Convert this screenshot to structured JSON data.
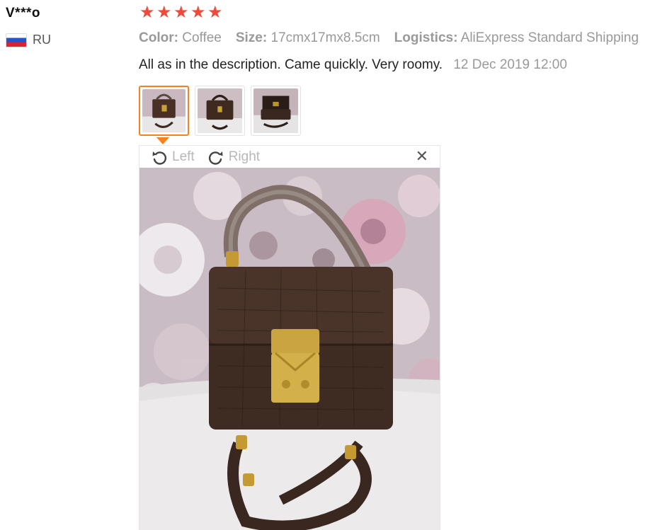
{
  "reviewer": {
    "name": "V***o",
    "country": "RU"
  },
  "rating": {
    "stars": 5,
    "max": 5,
    "color": "#f04a3a"
  },
  "attributes": {
    "color_key": "Color:",
    "color_value": "Coffee",
    "size_key": "Size:",
    "size_value": "17cmx17mx8.5cm",
    "logistics_key": "Logistics:",
    "logistics_value": "AliExpress Standard Shipping"
  },
  "review": {
    "text": "All as in the description. Came quickly. Very roomy.",
    "date": "12 Dec 2019 12:00"
  },
  "viewer": {
    "left_label": "Left",
    "right_label": "Right"
  },
  "colors": {
    "accent": "#f5821f"
  }
}
